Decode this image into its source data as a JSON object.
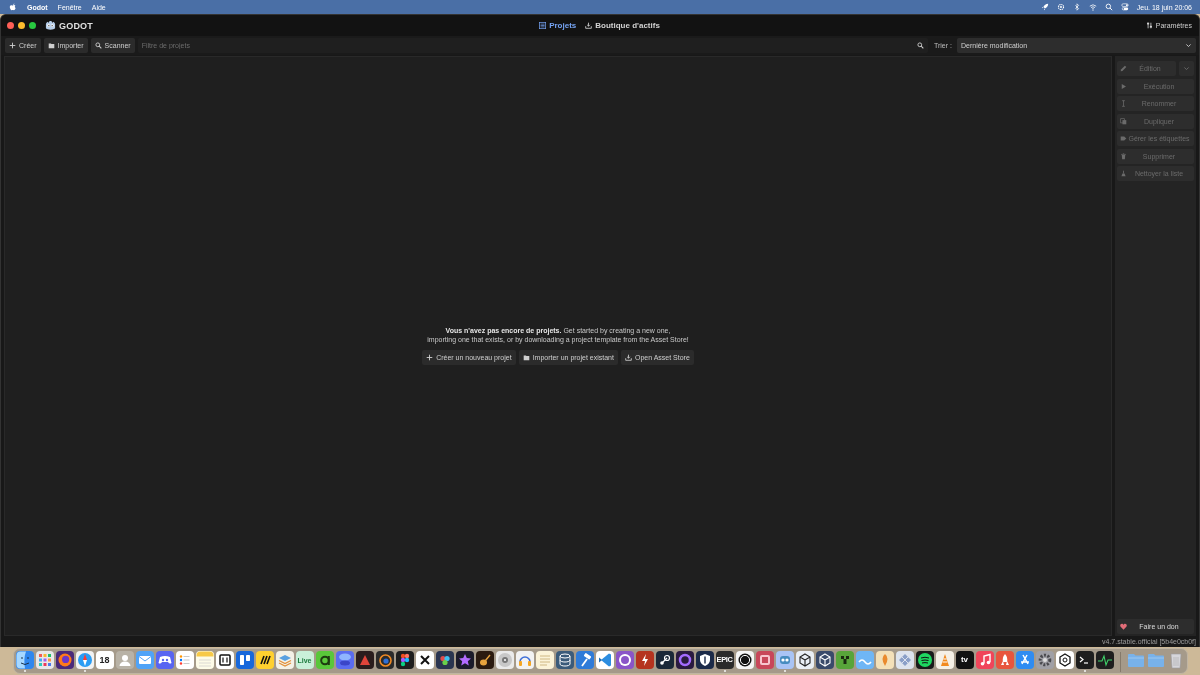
{
  "menu_bar": {
    "app_name": "Godot",
    "menus": [
      "Fenêtre",
      "Aide"
    ],
    "clock": "Jeu. 18 juin 20:06"
  },
  "window": {
    "logo_text": "GODOT",
    "tabs": [
      {
        "label": "Projets",
        "selected": true
      },
      {
        "label": "Boutique d'actifs",
        "selected": false
      }
    ],
    "settings": "Paramètres"
  },
  "toolbar": {
    "buttons": [
      "Créer",
      "Importer",
      "Scanner"
    ],
    "filter": {
      "placeholder": "Filtre de projets"
    },
    "sort_label": "Trier :",
    "sort_value": "Dernière modification"
  },
  "empty_state": {
    "message": "**Vous n'avez pas encore de projets.** Get started by creating a new one,\nimporting one that exists, or by downloading a project template from the Asset Store!",
    "buttons": [
      "Créer un nouveau projet",
      "Importer un projet existant",
      "Open Asset Store"
    ]
  },
  "sidebar": {
    "actions": [
      {
        "label": "Édition",
        "kind": "split",
        "disabled": true
      },
      {
        "label": "Exécution",
        "kind": "plain",
        "disabled": true
      },
      {
        "label": "Renommer",
        "kind": "plain",
        "disabled": true
      },
      {
        "label": "Dupliquer",
        "kind": "plain",
        "disabled": true
      },
      {
        "label": "Gérer les étiquettes",
        "kind": "plain",
        "disabled": true
      },
      {
        "label": "Supprimer",
        "kind": "plain",
        "disabled": true
      },
      {
        "label": "Nettoyer la liste",
        "kind": "plain",
        "disabled": true
      }
    ],
    "donate": "Faire un don"
  },
  "version": "v4.7.stable.official [5b4e0cb0f]",
  "dock": {
    "items": [
      {
        "running": true
      },
      {
        "running": false
      },
      {
        "running": false
      },
      {
        "running": true
      },
      {
        "running": false,
        "label": "18"
      },
      {
        "running": false
      },
      {
        "running": false
      },
      {
        "running": false
      },
      {
        "running": false
      },
      {
        "running": false
      },
      {
        "running": false
      },
      {
        "running": false
      },
      {
        "running": false
      },
      {
        "running": false
      },
      {
        "running": false,
        "label": "Live"
      },
      {
        "running": false
      },
      {
        "running": false
      },
      {
        "running": false
      },
      {
        "running": false
      },
      {
        "running": false
      },
      {
        "running": false
      },
      {
        "running": false
      },
      {
        "running": false
      },
      {
        "running": false
      },
      {
        "running": false
      },
      {
        "running": false
      },
      {
        "running": false
      },
      {
        "running": false
      },
      {
        "running": false
      },
      {
        "running": false
      },
      {
        "running": false
      },
      {
        "running": false
      },
      {
        "running": false
      },
      {
        "running": false
      },
      {
        "running": false
      },
      {
        "running": true,
        "label": "EPIC"
      },
      {
        "running": false
      },
      {
        "running": false
      },
      {
        "running": true
      },
      {
        "running": false
      },
      {
        "running": false
      },
      {
        "running": false
      },
      {
        "running": false
      },
      {
        "running": false
      },
      {
        "running": false
      },
      {
        "running": false
      },
      {
        "running": false
      },
      {
        "running": false,
        "label": "tv"
      },
      {
        "running": false
      },
      {
        "running": false
      },
      {
        "running": false
      },
      {
        "running": false
      },
      {
        "running": false
      },
      {
        "running": true
      },
      {
        "running": false
      },
      {
        "running": false
      },
      {
        "running": false
      },
      {
        "running": false
      }
    ]
  }
}
